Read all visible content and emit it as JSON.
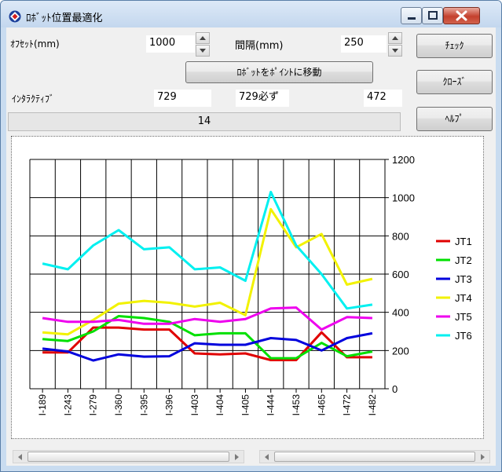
{
  "window": {
    "title": "ﾛﾎﾞｯﾄ位置最適化"
  },
  "controls": {
    "offset_label": "ｵﾌｾｯﾄ(mm)",
    "offset_value": "1000",
    "interval_label": "間隔(mm)",
    "interval_value": "250",
    "move_button": "ﾛﾎﾞｯﾄをﾎﾟｲﾝﾄに移動",
    "interactive_label": "ｲﾝﾀﾗｸﾃｨﾌﾞ",
    "value_a": "729",
    "value_b": "729必ず",
    "value_c": "472",
    "progress_text": "14",
    "check_button": "ﾁｪｯｸ",
    "close_button": "ｸﾛｰｽﾞ",
    "help_button": "ﾍﾙﾌﾟ"
  },
  "chart_data": {
    "type": "line",
    "categories": [
      "I-189",
      "I-243",
      "I-279",
      "I-360",
      "I-395",
      "I-396",
      "I-403",
      "I-404",
      "I-405",
      "I-444",
      "I-453",
      "I-465",
      "I-472",
      "I-482"
    ],
    "ylim": [
      0,
      1200
    ],
    "yticks": [
      "0",
      "200",
      "400",
      "600",
      "800",
      "1000",
      "1200"
    ],
    "y_axis_position": "right",
    "grid": true,
    "legend_position": "right",
    "series": [
      {
        "name": "JT1",
        "color": "#e00000",
        "values": [
          190,
          190,
          320,
          320,
          310,
          310,
          185,
          180,
          185,
          150,
          150,
          295,
          165,
          165
        ]
      },
      {
        "name": "JT2",
        "color": "#00e000",
        "values": [
          260,
          250,
          300,
          380,
          370,
          350,
          280,
          290,
          290,
          160,
          160,
          240,
          170,
          195
        ]
      },
      {
        "name": "JT3",
        "color": "#0000dd",
        "values": [
          210,
          195,
          148,
          180,
          168,
          170,
          238,
          230,
          230,
          265,
          255,
          200,
          265,
          290
        ]
      },
      {
        "name": "JT4",
        "color": "#f2f200",
        "values": [
          295,
          285,
          360,
          445,
          460,
          450,
          430,
          450,
          385,
          940,
          740,
          810,
          545,
          575
        ]
      },
      {
        "name": "JT5",
        "color": "#ee00ee",
        "values": [
          370,
          350,
          350,
          360,
          340,
          340,
          365,
          350,
          365,
          420,
          425,
          310,
          375,
          370
        ]
      },
      {
        "name": "JT6",
        "color": "#00f0f0",
        "values": [
          655,
          625,
          750,
          830,
          730,
          740,
          625,
          635,
          565,
          1030,
          750,
          600,
          420,
          440
        ]
      }
    ]
  }
}
